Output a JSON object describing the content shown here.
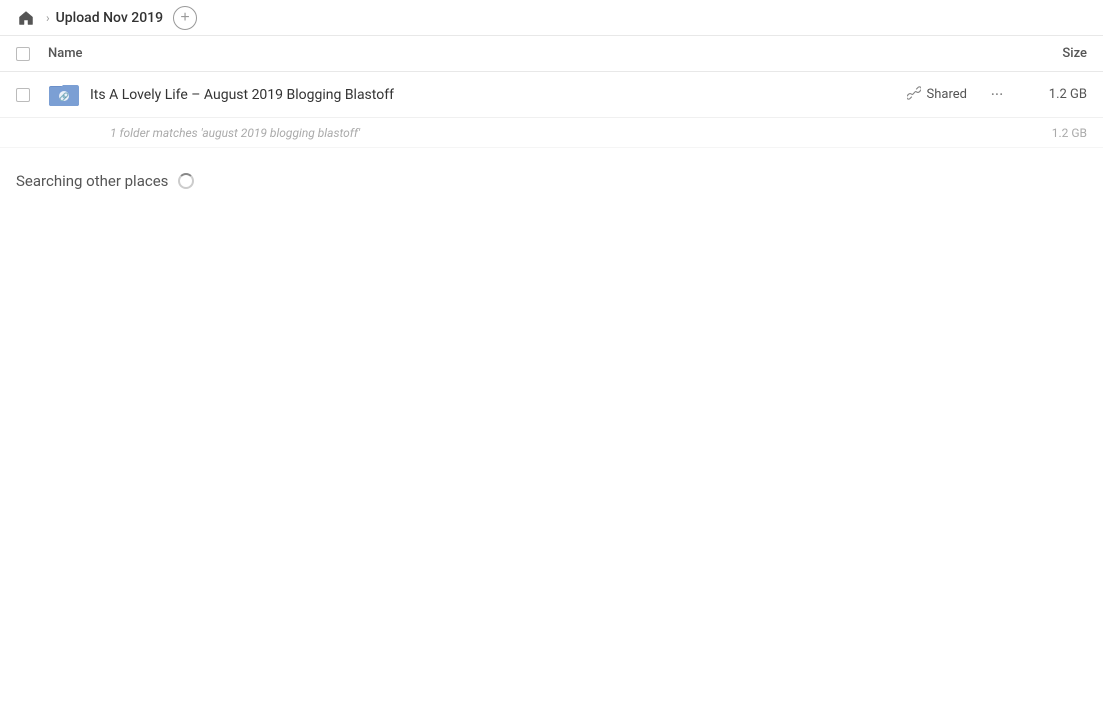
{
  "header": {
    "home_tooltip": "Home",
    "breadcrumb_title": "Upload Nov 2019",
    "add_button_label": "+"
  },
  "columns": {
    "name_label": "Name",
    "size_label": "Size"
  },
  "file_row": {
    "name": "Its A Lovely Life – August 2019 Blogging Blastoff",
    "shared_label": "Shared",
    "more_label": "···",
    "size": "1.2 GB"
  },
  "match_row": {
    "text": "1 folder matches 'august 2019 blogging blastoff'",
    "size": "1.2 GB"
  },
  "searching": {
    "label": "Searching other places"
  }
}
